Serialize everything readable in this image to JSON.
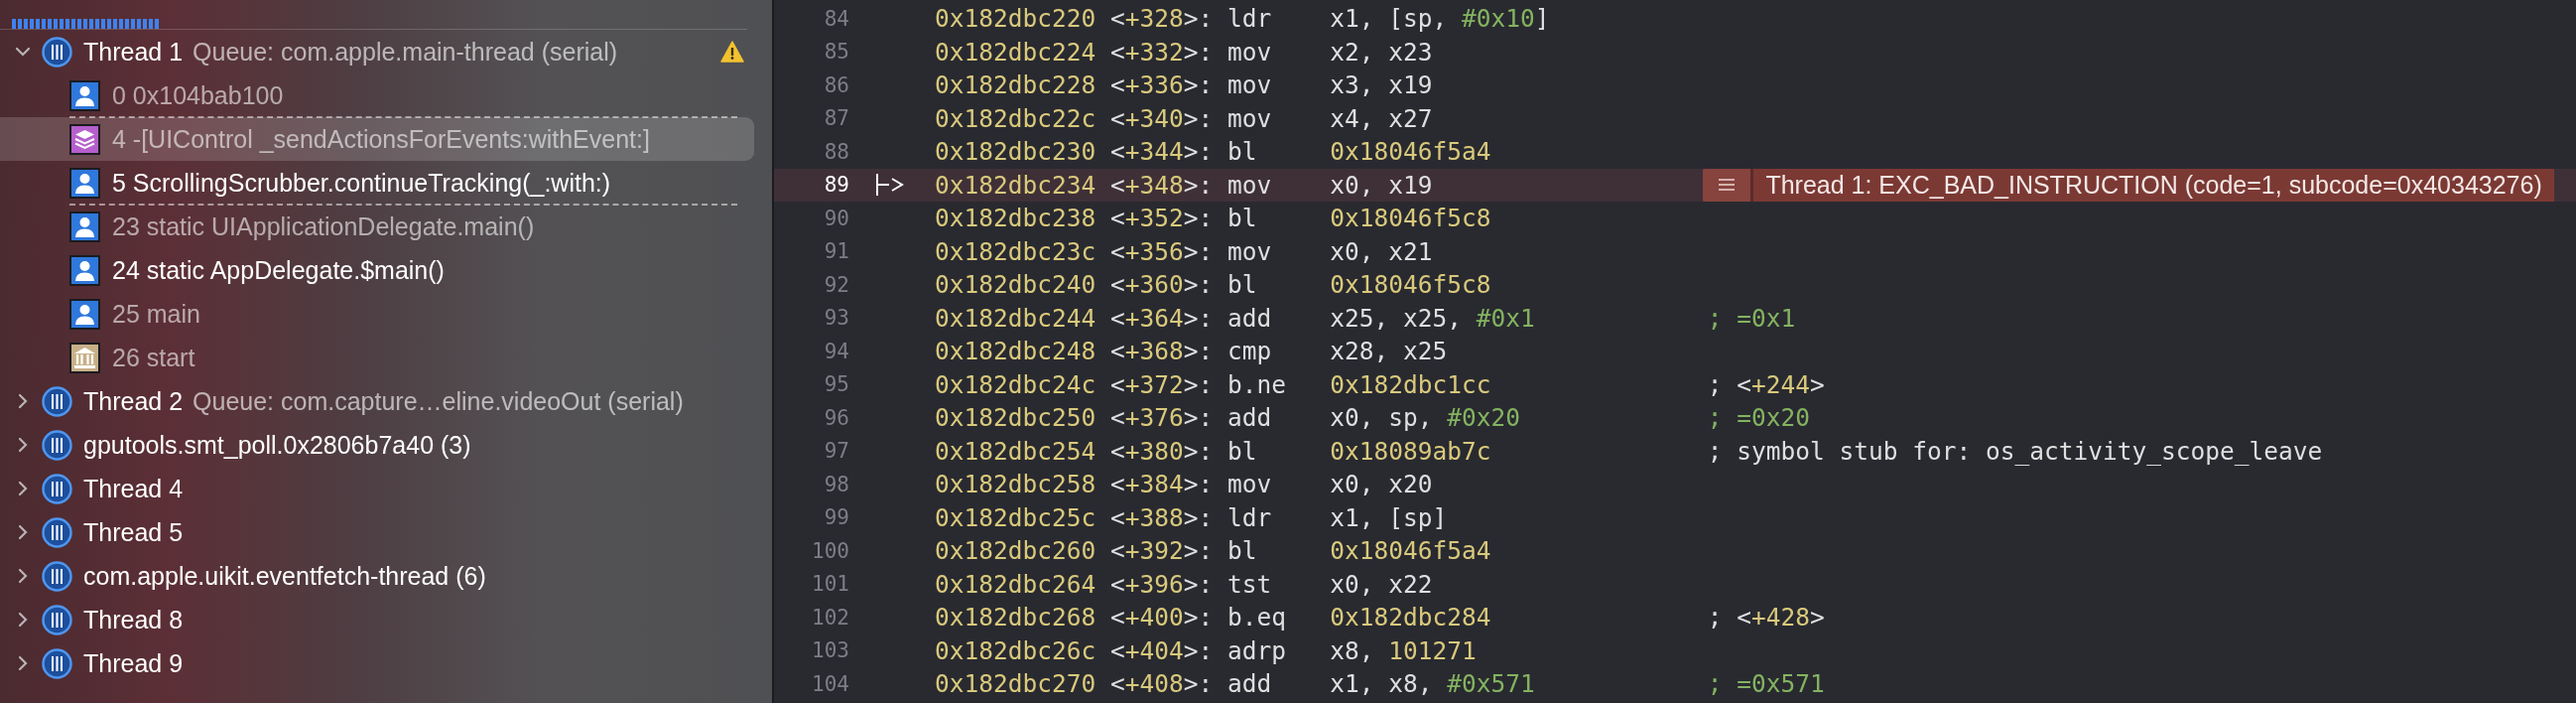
{
  "threads": [
    {
      "title": "Thread 1",
      "subtitle": "Queue: com.apple.main-thread (serial)",
      "expanded": true,
      "warning": true,
      "frames": [
        {
          "kind": "user",
          "label": "0 0x104bab100",
          "dimmed": true,
          "selected": false,
          "gap_after": true
        },
        {
          "kind": "framework",
          "label": "4 -[UIControl _sendActionsForEvents:withEvent:]",
          "dimmed": true,
          "selected": true,
          "gap_after": false
        },
        {
          "kind": "user",
          "label": "5 ScrollingScrubber.continueTracking(_:with:)",
          "dimmed": false,
          "selected": false,
          "gap_after": true
        },
        {
          "kind": "user",
          "label": "23 static UIApplicationDelegate.main()",
          "dimmed": true,
          "selected": false,
          "gap_after": false
        },
        {
          "kind": "user",
          "label": "24 static AppDelegate.$main()",
          "dimmed": false,
          "selected": false,
          "gap_after": false
        },
        {
          "kind": "user",
          "label": "25 main",
          "dimmed": true,
          "selected": false,
          "gap_after": false
        },
        {
          "kind": "library",
          "label": "26 start",
          "dimmed": true,
          "selected": false,
          "gap_after": false
        }
      ]
    },
    {
      "title": "Thread 2",
      "subtitle": "Queue: com.capture…eline.videoOut (serial)",
      "expanded": false,
      "warning": false
    },
    {
      "title": "gputools.smt_poll.0x2806b7a40 (3)",
      "expanded": false,
      "warning": false
    },
    {
      "title": "Thread 4",
      "expanded": false,
      "warning": false
    },
    {
      "title": "Thread 5",
      "expanded": false,
      "warning": false
    },
    {
      "title": "com.apple.uikit.eventfetch-thread (6)",
      "expanded": false,
      "warning": false
    },
    {
      "title": "Thread 8",
      "expanded": false,
      "warning": false
    },
    {
      "title": "Thread 9",
      "expanded": false,
      "warning": false
    }
  ],
  "lines": [
    {
      "number": "84",
      "address": "0x182dbc220",
      "offset": [
        {
          "text": "<",
          "kind": "plain"
        },
        {
          "text": "+328",
          "kind": "number"
        },
        {
          "text": ">:",
          "kind": "plain"
        }
      ],
      "mnemonic": "ldr",
      "operands": [
        {
          "text": "x1, [sp, ",
          "kind": "plain"
        },
        {
          "text": "#0x10",
          "kind": "immediate"
        },
        {
          "text": "]",
          "kind": "plain"
        }
      ],
      "current": false
    },
    {
      "number": "85",
      "address": "0x182dbc224",
      "offset": [
        {
          "text": "<",
          "kind": "plain"
        },
        {
          "text": "+332",
          "kind": "number"
        },
        {
          "text": ">:",
          "kind": "plain"
        }
      ],
      "mnemonic": "mov",
      "operands": [
        {
          "text": "x2, x23",
          "kind": "plain"
        }
      ],
      "current": false
    },
    {
      "number": "86",
      "address": "0x182dbc228",
      "offset": [
        {
          "text": "<",
          "kind": "plain"
        },
        {
          "text": "+336",
          "kind": "number"
        },
        {
          "text": ">:",
          "kind": "plain"
        }
      ],
      "mnemonic": "mov",
      "operands": [
        {
          "text": "x3, x19",
          "kind": "plain"
        }
      ],
      "current": false
    },
    {
      "number": "87",
      "address": "0x182dbc22c",
      "offset": [
        {
          "text": "<",
          "kind": "plain"
        },
        {
          "text": "+340",
          "kind": "number"
        },
        {
          "text": ">:",
          "kind": "plain"
        }
      ],
      "mnemonic": "mov",
      "operands": [
        {
          "text": "x4, x27",
          "kind": "plain"
        }
      ],
      "current": false
    },
    {
      "number": "88",
      "address": "0x182dbc230",
      "offset": [
        {
          "text": "<",
          "kind": "plain"
        },
        {
          "text": "+344",
          "kind": "number"
        },
        {
          "text": ">:",
          "kind": "plain"
        }
      ],
      "mnemonic": "bl",
      "operands": [
        {
          "text": "0x18046f5a4",
          "kind": "number"
        }
      ],
      "current": false
    },
    {
      "number": "89",
      "address": "0x182dbc234",
      "offset": [
        {
          "text": "<",
          "kind": "plain"
        },
        {
          "text": "+348",
          "kind": "number"
        },
        {
          "text": ">:",
          "kind": "plain"
        }
      ],
      "mnemonic": "mov",
      "operands": [
        {
          "text": "x0, x19",
          "kind": "plain"
        }
      ],
      "current": true,
      "error": "Thread 1: EXC_BAD_INSTRUCTION (code=1, subcode=0x40343276)"
    },
    {
      "number": "90",
      "address": "0x182dbc238",
      "offset": [
        {
          "text": "<",
          "kind": "plain"
        },
        {
          "text": "+352",
          "kind": "number"
        },
        {
          "text": ">:",
          "kind": "plain"
        }
      ],
      "mnemonic": "bl",
      "operands": [
        {
          "text": "0x18046f5c8",
          "kind": "number"
        }
      ],
      "current": false
    },
    {
      "number": "91",
      "address": "0x182dbc23c",
      "offset": [
        {
          "text": "<",
          "kind": "plain"
        },
        {
          "text": "+356",
          "kind": "number"
        },
        {
          "text": ">:",
          "kind": "plain"
        }
      ],
      "mnemonic": "mov",
      "operands": [
        {
          "text": "x0, x21",
          "kind": "plain"
        }
      ],
      "current": false
    },
    {
      "number": "92",
      "address": "0x182dbc240",
      "offset": [
        {
          "text": "<",
          "kind": "plain"
        },
        {
          "text": "+360",
          "kind": "number"
        },
        {
          "text": ">:",
          "kind": "plain"
        }
      ],
      "mnemonic": "bl",
      "operands": [
        {
          "text": "0x18046f5c8",
          "kind": "number"
        }
      ],
      "current": false
    },
    {
      "number": "93",
      "address": "0x182dbc244",
      "offset": [
        {
          "text": "<",
          "kind": "plain"
        },
        {
          "text": "+364",
          "kind": "number"
        },
        {
          "text": ">:",
          "kind": "plain"
        }
      ],
      "mnemonic": "add",
      "operands": [
        {
          "text": "x25, x25, ",
          "kind": "plain"
        },
        {
          "text": "#0x1",
          "kind": "immediate"
        }
      ],
      "comment": [
        {
          "text": "; =0x1",
          "kind": "immediate"
        }
      ],
      "current": false
    },
    {
      "number": "94",
      "address": "0x182dbc248",
      "offset": [
        {
          "text": "<",
          "kind": "plain"
        },
        {
          "text": "+368",
          "kind": "number"
        },
        {
          "text": ">:",
          "kind": "plain"
        }
      ],
      "mnemonic": "cmp",
      "operands": [
        {
          "text": "x28, x25",
          "kind": "plain"
        }
      ],
      "current": false
    },
    {
      "number": "95",
      "address": "0x182dbc24c",
      "offset": [
        {
          "text": "<",
          "kind": "plain"
        },
        {
          "text": "+372",
          "kind": "number"
        },
        {
          "text": ">:",
          "kind": "plain"
        }
      ],
      "mnemonic": "b.ne",
      "operands": [
        {
          "text": "0x182dbc1cc",
          "kind": "number"
        }
      ],
      "comment": [
        {
          "text": "; <",
          "kind": "plain"
        },
        {
          "text": "+244",
          "kind": "number"
        },
        {
          "text": ">",
          "kind": "plain"
        }
      ],
      "current": false
    },
    {
      "number": "96",
      "address": "0x182dbc250",
      "offset": [
        {
          "text": "<",
          "kind": "plain"
        },
        {
          "text": "+376",
          "kind": "number"
        },
        {
          "text": ">:",
          "kind": "plain"
        }
      ],
      "mnemonic": "add",
      "operands": [
        {
          "text": "x0, sp, ",
          "kind": "plain"
        },
        {
          "text": "#0x20",
          "kind": "immediate"
        }
      ],
      "comment": [
        {
          "text": "; =0x20",
          "kind": "immediate"
        }
      ],
      "current": false
    },
    {
      "number": "97",
      "address": "0x182dbc254",
      "offset": [
        {
          "text": "<",
          "kind": "plain"
        },
        {
          "text": "+380",
          "kind": "number"
        },
        {
          "text": ">:",
          "kind": "plain"
        }
      ],
      "mnemonic": "bl",
      "operands": [
        {
          "text": "0x18089ab7c",
          "kind": "number"
        }
      ],
      "comment": [
        {
          "text": "; symbol stub for: os_activity_scope_leave",
          "kind": "plain"
        }
      ],
      "current": false
    },
    {
      "number": "98",
      "address": "0x182dbc258",
      "offset": [
        {
          "text": "<",
          "kind": "plain"
        },
        {
          "text": "+384",
          "kind": "number"
        },
        {
          "text": ">:",
          "kind": "plain"
        }
      ],
      "mnemonic": "mov",
      "operands": [
        {
          "text": "x0, x20",
          "kind": "plain"
        }
      ],
      "current": false
    },
    {
      "number": "99",
      "address": "0x182dbc25c",
      "offset": [
        {
          "text": "<",
          "kind": "plain"
        },
        {
          "text": "+388",
          "kind": "number"
        },
        {
          "text": ">:",
          "kind": "plain"
        }
      ],
      "mnemonic": "ldr",
      "operands": [
        {
          "text": "x1, [sp]",
          "kind": "plain"
        }
      ],
      "current": false
    },
    {
      "number": "100",
      "address": "0x182dbc260",
      "offset": [
        {
          "text": "<",
          "kind": "plain"
        },
        {
          "text": "+392",
          "kind": "number"
        },
        {
          "text": ">:",
          "kind": "plain"
        }
      ],
      "mnemonic": "bl",
      "operands": [
        {
          "text": "0x18046f5a4",
          "kind": "number"
        }
      ],
      "current": false
    },
    {
      "number": "101",
      "address": "0x182dbc264",
      "offset": [
        {
          "text": "<",
          "kind": "plain"
        },
        {
          "text": "+396",
          "kind": "number"
        },
        {
          "text": ">:",
          "kind": "plain"
        }
      ],
      "mnemonic": "tst",
      "operands": [
        {
          "text": "x0, x22",
          "kind": "plain"
        }
      ],
      "current": false
    },
    {
      "number": "102",
      "address": "0x182dbc268",
      "offset": [
        {
          "text": "<",
          "kind": "plain"
        },
        {
          "text": "+400",
          "kind": "number"
        },
        {
          "text": ">:",
          "kind": "plain"
        }
      ],
      "mnemonic": "b.eq",
      "operands": [
        {
          "text": "0x182dbc284",
          "kind": "number"
        }
      ],
      "comment": [
        {
          "text": "; <",
          "kind": "plain"
        },
        {
          "text": "+428",
          "kind": "number"
        },
        {
          "text": ">",
          "kind": "plain"
        }
      ],
      "current": false
    },
    {
      "number": "103",
      "address": "0x182dbc26c",
      "offset": [
        {
          "text": "<",
          "kind": "plain"
        },
        {
          "text": "+404",
          "kind": "number"
        },
        {
          "text": ">:",
          "kind": "plain"
        }
      ],
      "mnemonic": "adrp",
      "operands": [
        {
          "text": "x8, ",
          "kind": "plain"
        },
        {
          "text": "101271",
          "kind": "number"
        }
      ],
      "current": false
    },
    {
      "number": "104",
      "address": "0x182dbc270",
      "offset": [
        {
          "text": "<",
          "kind": "plain"
        },
        {
          "text": "+408",
          "kind": "number"
        },
        {
          "text": ">:",
          "kind": "plain"
        }
      ],
      "mnemonic": "add",
      "operands": [
        {
          "text": "x1, x8, ",
          "kind": "plain"
        },
        {
          "text": "#0x571",
          "kind": "immediate"
        }
      ],
      "comment": [
        {
          "text": "; =0x571",
          "kind": "immediate"
        }
      ],
      "current": false
    }
  ]
}
